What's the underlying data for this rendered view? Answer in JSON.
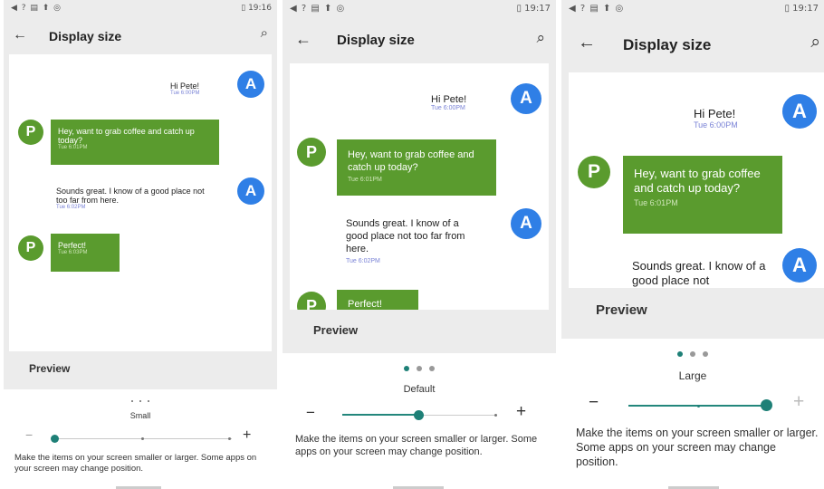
{
  "screens": [
    {
      "status": {
        "icons": "◀ ? ▤ ⬆ ◎",
        "battery_time": "▯ 19:16"
      },
      "header": {
        "title": "Display size"
      },
      "messages": [
        {
          "text": "Hi Pete!",
          "time": "Tue 6:00PM"
        },
        {
          "text": "Hey, want to grab coffee and catch up today?",
          "time": "Tue 6:01PM"
        },
        {
          "text": "Sounds great. I know of a good place not too far from here.",
          "time": "Tue 6:02PM"
        },
        {
          "text": "Perfect!",
          "time": "Tue 6:03PM"
        }
      ],
      "avatars": {
        "a": "A",
        "p": "P"
      },
      "preview_label": "Preview",
      "size_name": "Small",
      "slider_level": "1 of 3",
      "description": "Make the items on your screen smaller or larger. Some apps on your screen may change position."
    },
    {
      "status": {
        "icons": "◀ ? ▤ ⬆ ◎",
        "battery_time": "▯ 19:17"
      },
      "header": {
        "title": "Display size"
      },
      "messages": [
        {
          "text": "Hi Pete!",
          "time": "Tue 6:00PM"
        },
        {
          "text": "Hey, want to grab coffee and catch up today?",
          "time": "Tue 6:01PM"
        },
        {
          "text": "Sounds great. I know of a good place not too far from here.",
          "time": "Tue 6:02PM"
        },
        {
          "text": "Perfect!",
          "time": ""
        }
      ],
      "avatars": {
        "a": "A",
        "p": "P"
      },
      "preview_label": "Preview",
      "size_name": "Default",
      "slider_level": "2 of 3",
      "description": "Make the items on your screen smaller or larger. Some apps on your screen may change position."
    },
    {
      "status": {
        "icons": "◀ ? ▤ ⬆ ◎",
        "battery_time": "▯ 19:17"
      },
      "header": {
        "title": "Display size"
      },
      "messages": [
        {
          "text": "Hi Pete!",
          "time": "Tue 6:00PM"
        },
        {
          "text": "Hey, want to grab coffee and catch up today?",
          "time": "Tue 6:01PM"
        },
        {
          "text": "Sounds great. I know of a good place not",
          "time": ""
        }
      ],
      "avatars": {
        "a": "A",
        "p": "P"
      },
      "preview_label": "Preview",
      "size_name": "Large",
      "slider_level": "3 of 3",
      "description": "Make the items on your screen smaller or larger. Some apps on your screen may change position."
    }
  ],
  "colors": {
    "accent": "#1e8077",
    "bubble": "#5a9b2e",
    "avatar_a": "#2f7fe6",
    "time_blue": "#7a83d6"
  },
  "icons": {
    "back": "arrow-left-icon",
    "search": "search-icon",
    "minus": "minus-icon",
    "plus": "plus-icon"
  }
}
